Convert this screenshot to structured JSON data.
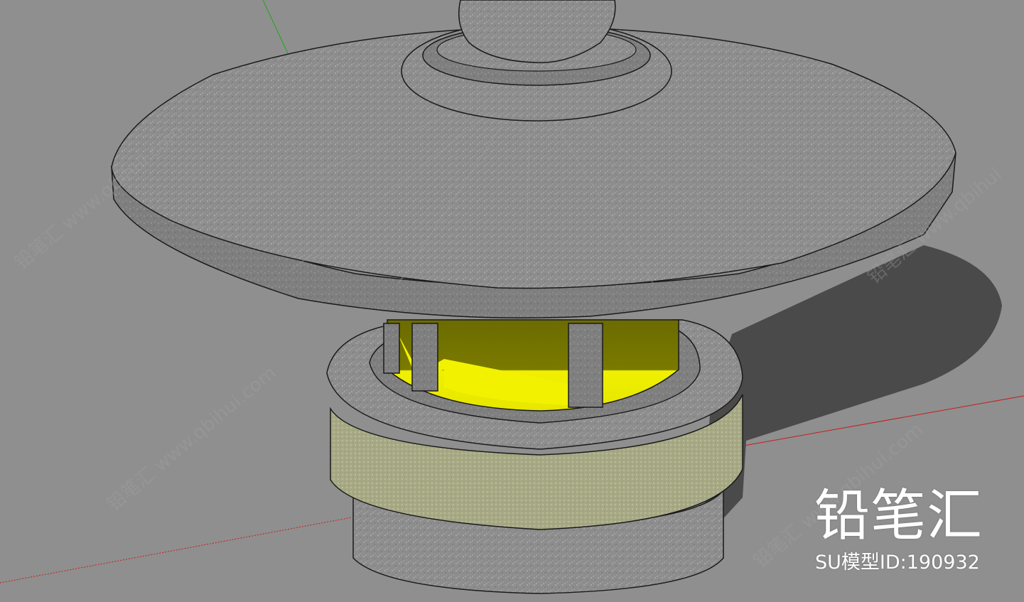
{
  "viewport": {
    "background_color": "#8f8f8f",
    "stone_color": "#8a8a8a",
    "light_color": "#f2f200",
    "band_color": "#a9ab87",
    "red_axis_color": "#c81c1c",
    "green_axis_color": "#1ca81c"
  },
  "watermark": {
    "brand": "铅笔汇",
    "model_id": "SU模型ID:190932"
  }
}
